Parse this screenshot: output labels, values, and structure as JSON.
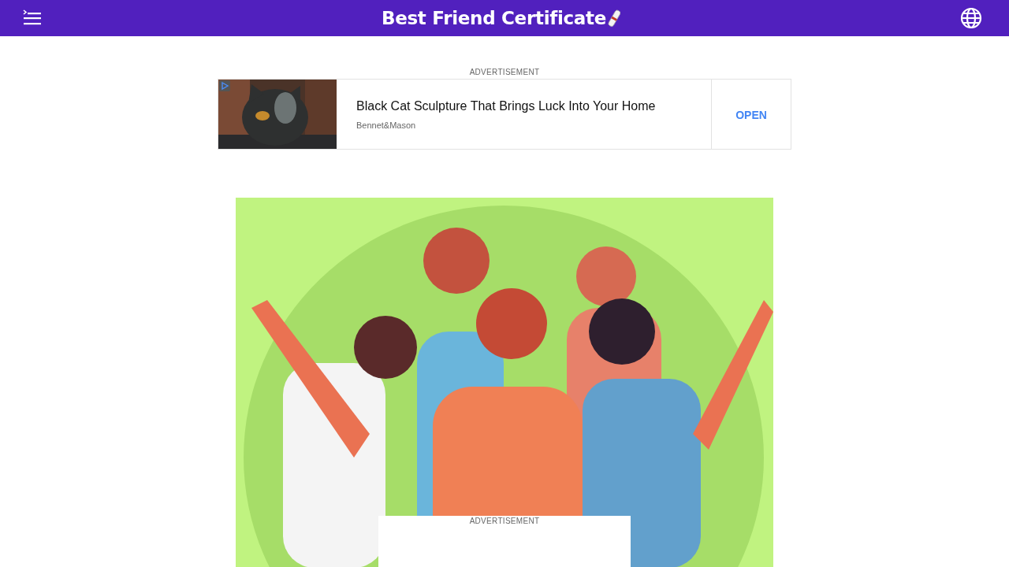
{
  "header": {
    "title": "Best Friend Certificate"
  },
  "top_ad": {
    "label": "ADVERTISEMENT",
    "headline": "Black Cat Sculpture That Brings Luck Into Your Home",
    "advertiser": "Bennet&Mason",
    "button": "OPEN"
  },
  "bottom_ad": {
    "label": "ADVERTISEMENT"
  }
}
